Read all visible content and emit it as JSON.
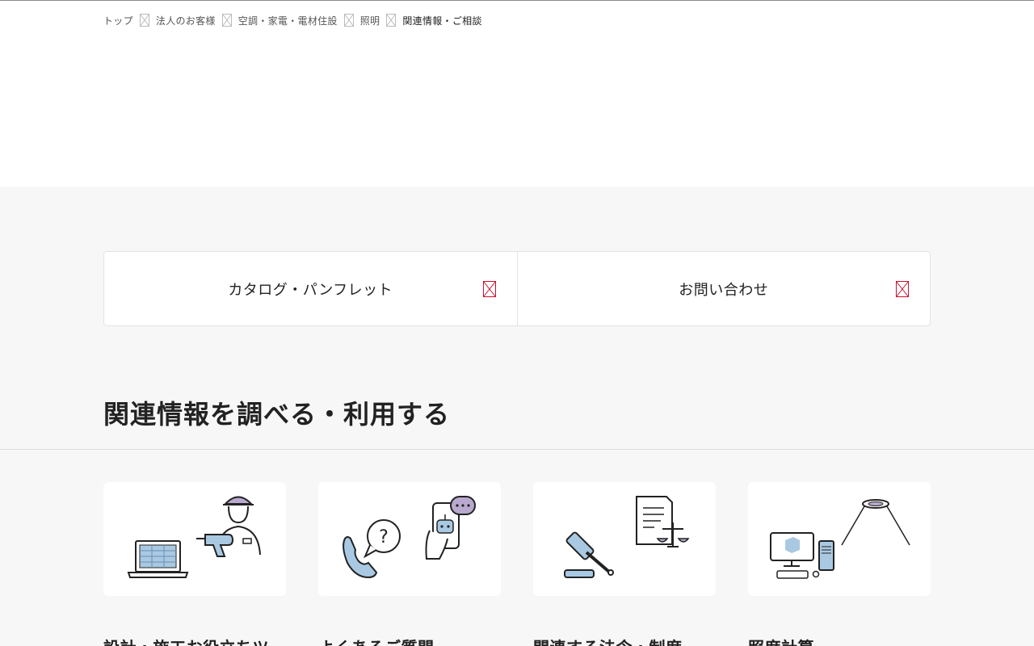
{
  "breadcrumb": {
    "items": [
      "トップ",
      "法人のお客様",
      "空調・家電・電材住設",
      "照明",
      "関連情報・ご相談"
    ]
  },
  "cta": {
    "catalog_label": "カタログ・パンフレット",
    "contact_label": "お問い合わせ"
  },
  "section": {
    "title": "関連情報を調べる・利用する"
  },
  "cards": [
    {
      "title": "設計・施工お役立ちツー",
      "icon": "worker-laptop-icon"
    },
    {
      "title": "よくあるご質問",
      "icon": "phone-chatbot-icon"
    },
    {
      "title": "関連する法令・制度",
      "icon": "gavel-document-icon"
    },
    {
      "title": "照度計算",
      "icon": "computer-light-icon"
    }
  ],
  "colors": {
    "accent_red": "#c8102e",
    "icon_blue": "#a9c9e3",
    "icon_purple": "#b9a9cf",
    "background_grey": "#f7f7f7"
  }
}
